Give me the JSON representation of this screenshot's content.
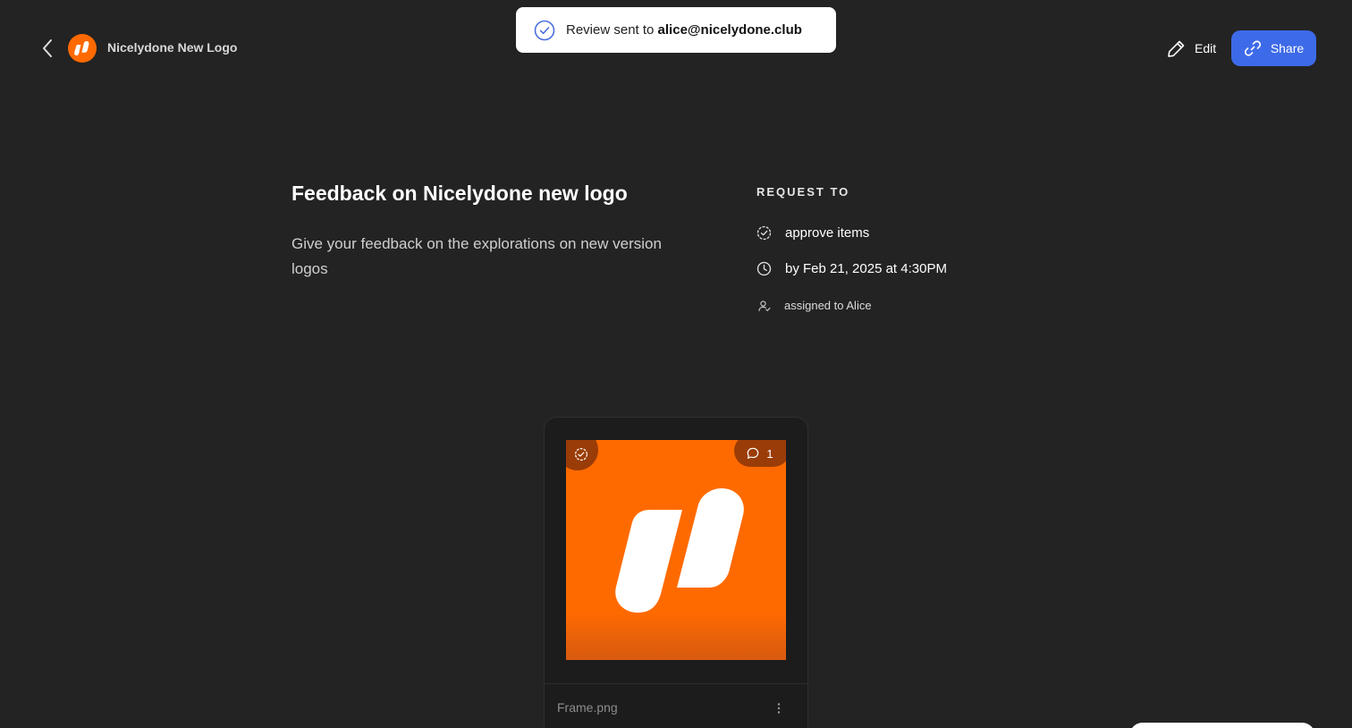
{
  "header": {
    "project_title": "Nicelydone New Logo",
    "edit_label": "Edit",
    "share_label": "Share"
  },
  "toast": {
    "prefix": "Review sent to ",
    "email": "alice@nicelydone.club"
  },
  "review": {
    "title": "Feedback on Nicelydone new logo",
    "description": "Give your feedback on the explorations on new version logos"
  },
  "request": {
    "heading": "REQUEST TO",
    "action": "approve items",
    "due": "by Feb 21, 2025 at 4:30PM",
    "assignee": "assigned to Alice"
  },
  "card": {
    "file_name": "Frame.png",
    "comment_count": "1"
  },
  "colors": {
    "background": "#232323",
    "brand_orange": "#ff6a00",
    "share_blue": "#3d6ae8",
    "toast_check": "#4a6ee0"
  },
  "icons": {
    "back": "chevron-left-icon",
    "edit": "pencil-icon",
    "share": "link-icon",
    "toast": "check-circle-icon",
    "approve": "badge-check-icon",
    "due": "clock-icon",
    "assignee": "user-check-icon",
    "comment": "comment-icon",
    "more": "kebab-icon"
  }
}
